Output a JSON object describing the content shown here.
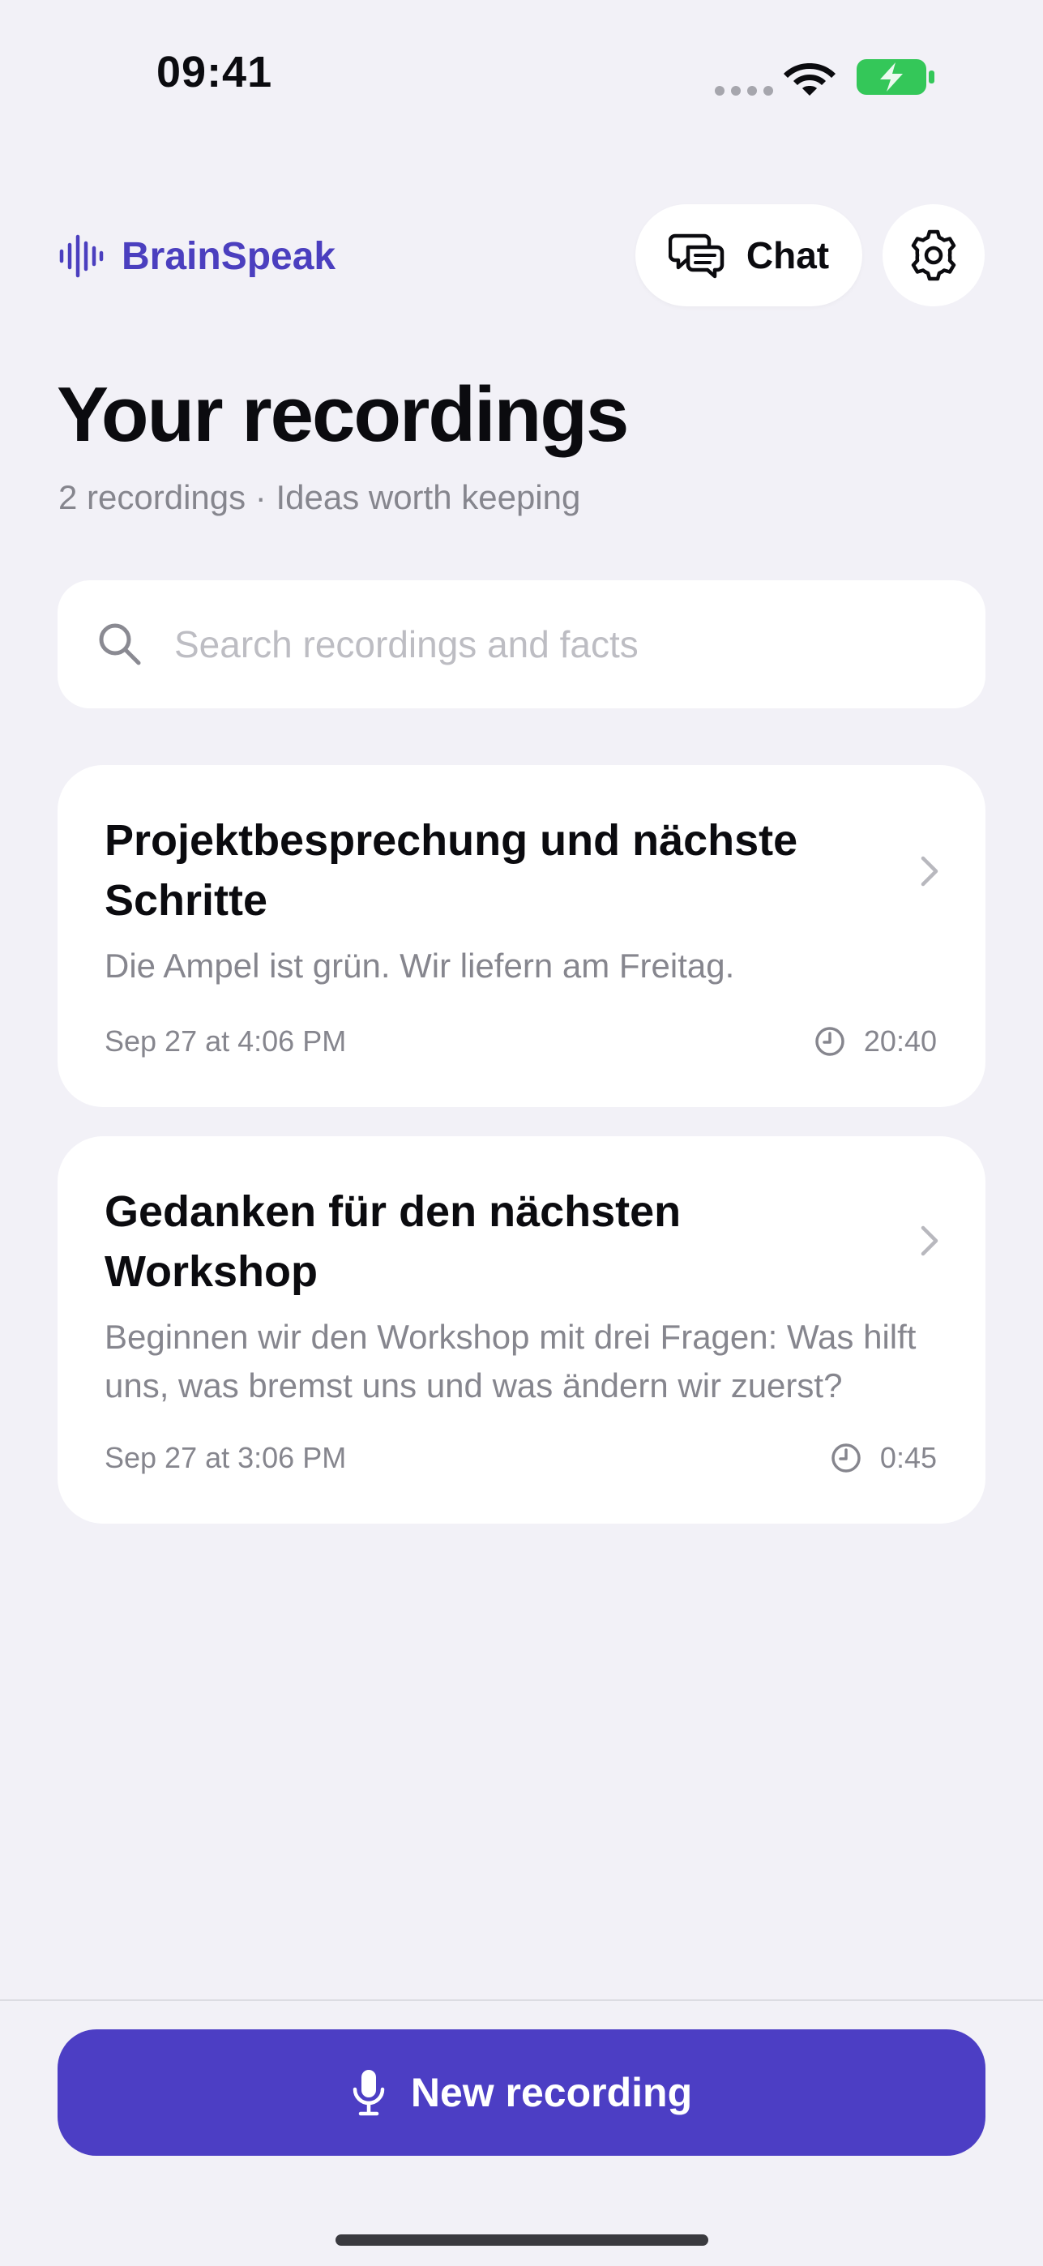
{
  "status_bar": {
    "time": "09:41",
    "battery_color": "#34c759"
  },
  "header": {
    "app_name": "BrainSpeak",
    "brand_color": "#4b3fbf",
    "chat_label": "Chat",
    "chat_icon": "chat-bubbles-icon",
    "settings_icon": "gear-icon"
  },
  "page": {
    "title": "Your recordings",
    "subtitle": "2 recordings · Ideas worth keeping"
  },
  "search": {
    "placeholder": "Search recordings and facts",
    "value": ""
  },
  "recordings": [
    {
      "title": "Projektbesprechung und nächste Schritte",
      "excerpt": "Die Ampel ist grün. Wir liefern am Freitag.",
      "date": "Sep 27 at 4:06 PM",
      "duration": "20:40"
    },
    {
      "title": "Gedanken für den nächsten Workshop",
      "excerpt": "Beginnen wir den Workshop mit drei Fragen: Was hilft uns, was bremst uns und was ändern wir zuerst?",
      "date": "Sep 27 at 3:06 PM",
      "duration": "0:45"
    }
  ],
  "footer": {
    "new_recording_label": "New recording",
    "button_color": "#4c3ec4",
    "mic_icon": "microphone-icon"
  }
}
